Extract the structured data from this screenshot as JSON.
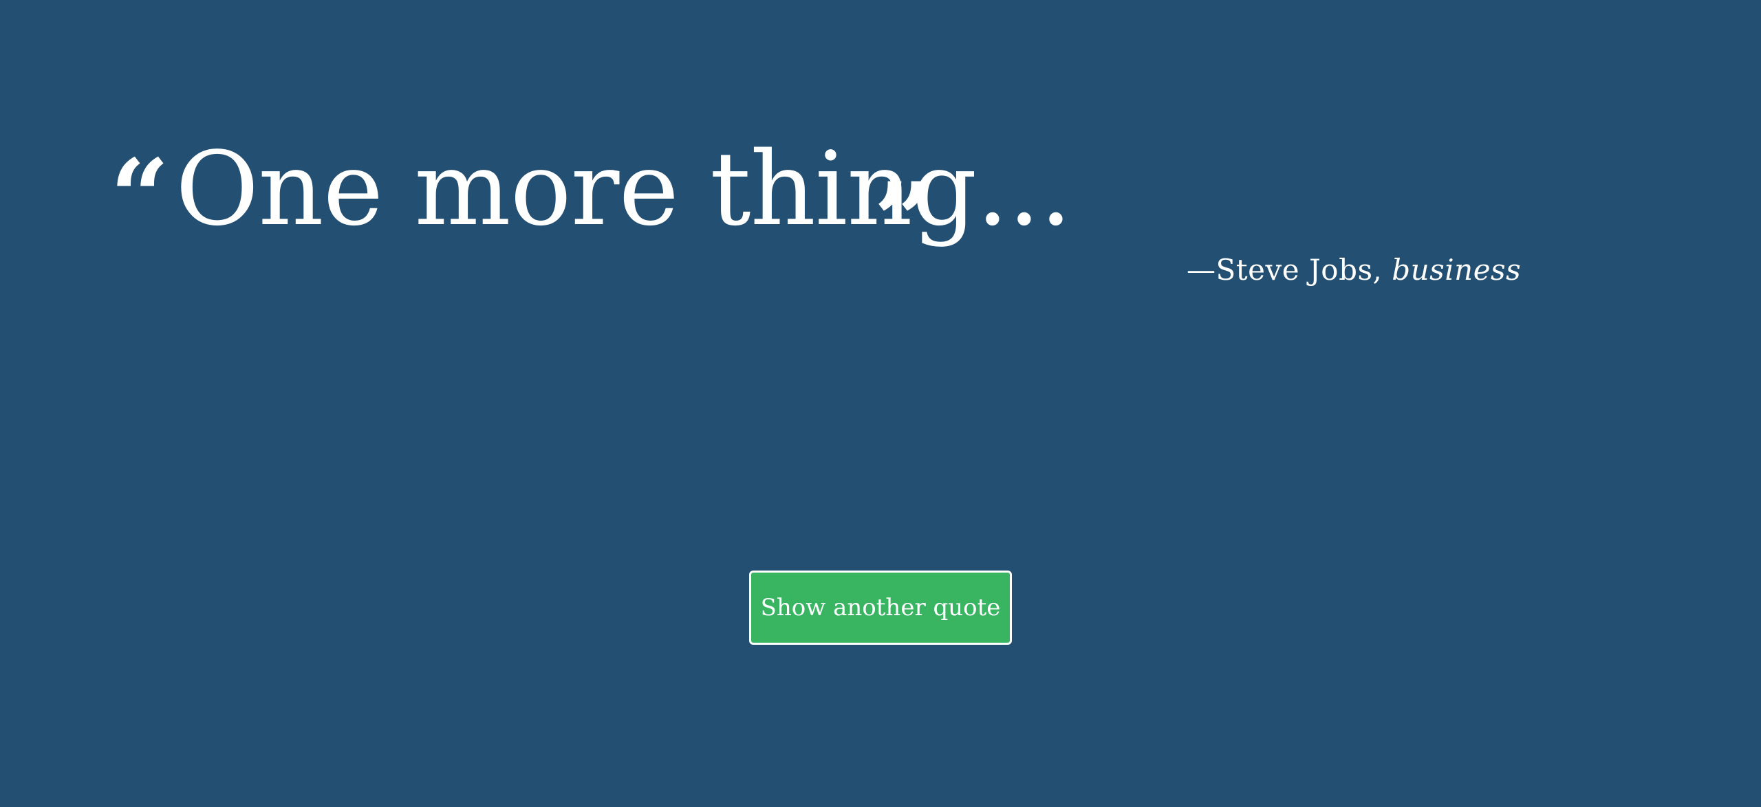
{
  "quote": {
    "open_mark": "“",
    "text": "One more thing...",
    "close_mark": "”"
  },
  "attribution": {
    "author": "—Steve Jobs,",
    "category": "business"
  },
  "actions": {
    "show_another_label": "Show another quote"
  },
  "colors": {
    "background": "#234f73",
    "button": "#39b461",
    "text": "#ffffff"
  }
}
